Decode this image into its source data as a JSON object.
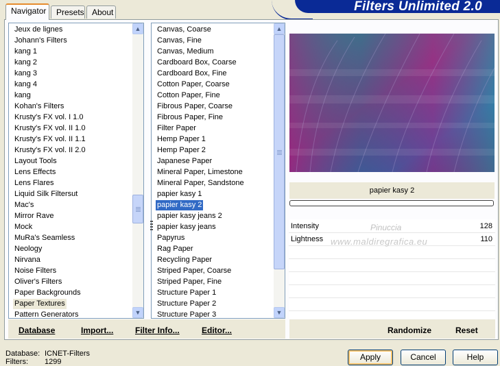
{
  "tabs": [
    {
      "label": "Navigator"
    },
    {
      "label": "Presets"
    },
    {
      "label": "About"
    }
  ],
  "header_title": "Filters Unlimited 2.0",
  "categories": {
    "items": [
      "Jeux de lignes",
      "Johann's Filters",
      "kang 1",
      "kang 2",
      "kang 3",
      "kang 4",
      "kang",
      "Kohan's Filters",
      "Krusty's FX vol. I 1.0",
      "Krusty's FX vol. II 1.0",
      "Krusty's FX vol. II 1.1",
      "Krusty's FX vol. II 2.0",
      "Layout Tools",
      "Lens Effects",
      "Lens Flares",
      "Liquid Silk Filtersut",
      "Mac's",
      "Mirror Rave",
      "Mock",
      "MuRa's Seamless",
      "Neology",
      "Nirvana",
      "Noise Filters",
      "Oliver's Filters",
      "Paper Backgrounds",
      "Paper Textures",
      "Pattern Generators"
    ],
    "selected": "Paper Textures",
    "scroll_position": 0.62
  },
  "filters": {
    "items": [
      "Canvas, Coarse",
      "Canvas, Fine",
      "Canvas, Medium",
      "Cardboard Box, Coarse",
      "Cardboard Box, Fine",
      "Cotton Paper, Coarse",
      "Cotton Paper, Fine",
      "Fibrous Paper, Coarse",
      "Fibrous Paper, Fine",
      "Filter Paper",
      "Hemp Paper 1",
      "Hemp Paper 2",
      "Japanese Paper",
      "Mineral Paper, Limestone",
      "Mineral Paper, Sandstone",
      "papier kasy 1",
      "papier kasy 2",
      "papier kasy jeans 2",
      "papier kasy jeans",
      "Papyrus",
      "Rag Paper",
      "Recycling Paper",
      "Striped Paper, Coarse",
      "Striped Paper, Fine",
      "Structure Paper 1",
      "Structure Paper 2",
      "Structure Paper 3"
    ],
    "selected": "papier kasy 2",
    "scroll_position": 0.5
  },
  "preview": {
    "filter_name": "papier kasy 2",
    "progress": 0,
    "colors": [
      "#2a8a8e",
      "#8a2a7e",
      "#3a4aa0",
      "#5a1a6a"
    ]
  },
  "params": [
    {
      "name": "Intensity",
      "value": "128"
    },
    {
      "name": "Lightness",
      "value": "110"
    }
  ],
  "watermark": {
    "line1": "Pinuccia",
    "line2": "www.maldiregrafica.eu"
  },
  "left_actions": {
    "database": "Database",
    "import": "Import...",
    "filter_info": "Filter Info...",
    "editor": "Editor..."
  },
  "right_actions": {
    "randomize": "Randomize",
    "reset": "Reset"
  },
  "status": {
    "database_label": "Database:",
    "database_value": "ICNET-Filters",
    "filters_label": "Filters:",
    "filters_value": "1299"
  },
  "dialog_buttons": {
    "apply": "Apply",
    "cancel": "Cancel",
    "help": "Help"
  }
}
